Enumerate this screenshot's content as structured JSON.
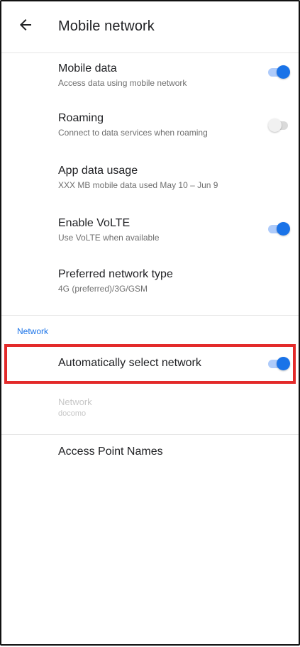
{
  "header": {
    "title": "Mobile network",
    "back_icon": "arrow-left-icon"
  },
  "settings": [
    {
      "title": "Mobile data",
      "summary": "Access data using mobile network",
      "toggle": true
    },
    {
      "title": "Roaming",
      "summary": "Connect to data services when roaming",
      "toggle": false
    },
    {
      "title": "App data usage",
      "summary": "XXX MB mobile data used May 10 – Jun 9",
      "toggle": null
    },
    {
      "title": "Enable VoLTE",
      "summary": "Use VoLTE when available",
      "toggle": true
    },
    {
      "title": "Preferred network type",
      "summary": "4G (preferred)/3G/GSM",
      "toggle": null
    }
  ],
  "network_section": {
    "header": "Network",
    "auto_select": {
      "title": "Automatically select network",
      "toggle": true
    },
    "network_item": {
      "title": "Network",
      "summary": "docomo"
    },
    "apn": {
      "title": "Access Point Names"
    }
  },
  "colors": {
    "accent": "#1a73e8",
    "highlight": "#e32a2a"
  }
}
